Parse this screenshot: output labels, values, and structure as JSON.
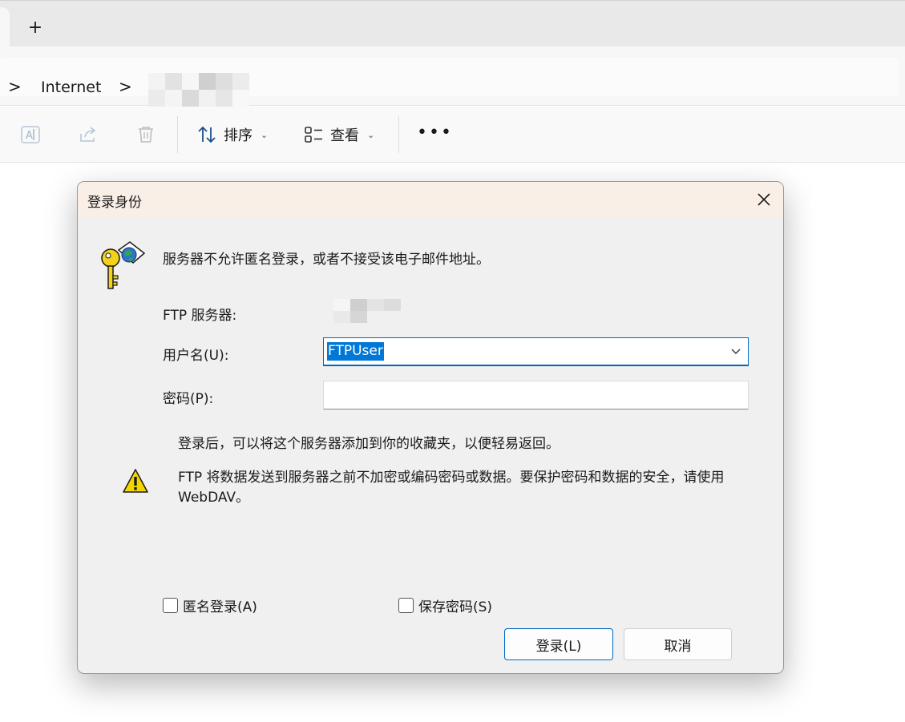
{
  "tabstrip": {
    "new_tab_label": "+"
  },
  "breadcrumb": {
    "items": [
      "Internet"
    ],
    "separator": ">"
  },
  "commandbar": {
    "sort_label": "排序",
    "view_label": "查看",
    "more_label": "•••",
    "icons": [
      "rename-icon",
      "share-icon",
      "delete-icon",
      "sort-icon",
      "view-icon"
    ]
  },
  "dialog": {
    "title": "登录身份",
    "message": "服务器不允许匿名登录，或者不接受该电子邮件地址。",
    "ftp_server_label": "FTP 服务器:",
    "username_label": "用户名(U):",
    "username_value": "FTPUser",
    "password_label": "密码(P):",
    "password_value": "",
    "note": "登录后，可以将这个服务器添加到你的收藏夹，以便轻易返回。",
    "warning": "FTP 将数据发送到服务器之前不加密或编码密码或数据。要保护密码和数据的安全，请使用 WebDAV。",
    "anonymous_label": "匿名登录(A)",
    "anonymous_checked": false,
    "save_password_label": "保存密码(S)",
    "save_password_checked": false,
    "login_button": "登录(L)",
    "cancel_button": "取消"
  },
  "colors": {
    "accent": "#0067c0",
    "selection": "#0078d7",
    "dialog_title_bg": "#f9efe7",
    "dialog_bg": "#f0f0f0",
    "warning_yellow": "#f2d600"
  }
}
